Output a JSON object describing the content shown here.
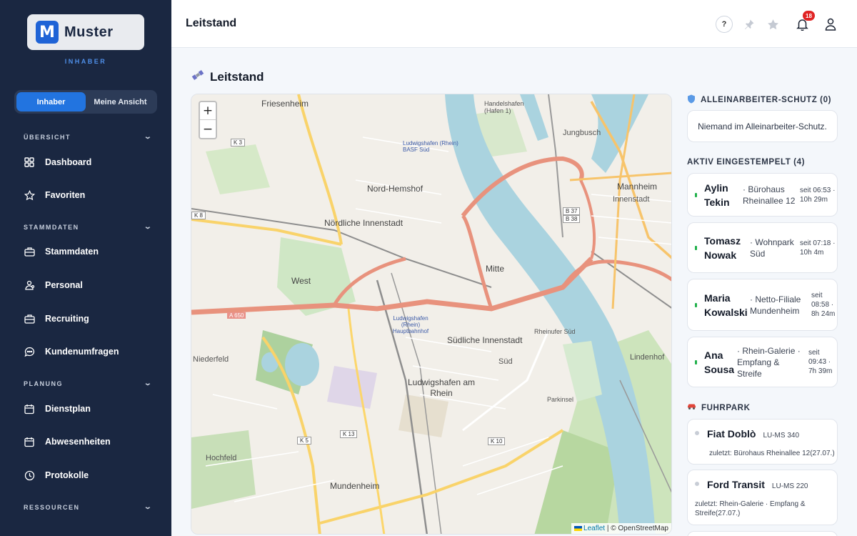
{
  "brand": {
    "name": "Muster",
    "logo_letter": "M",
    "role": "INHABER"
  },
  "view_toggle": {
    "options": [
      "Inhaber",
      "Meine Ansicht"
    ],
    "active": "Inhaber"
  },
  "sidebar": {
    "sections": [
      {
        "title": "ÜBERSICHT",
        "items": [
          {
            "label": "Dashboard",
            "icon": "grid-icon"
          },
          {
            "label": "Favoriten",
            "icon": "star-icon"
          }
        ]
      },
      {
        "title": "STAMMDATEN",
        "items": [
          {
            "label": "Stammdaten",
            "icon": "briefcase-icon"
          },
          {
            "label": "Personal",
            "icon": "people-icon"
          },
          {
            "label": "Recruiting",
            "icon": "briefcase-icon"
          },
          {
            "label": "Kundenumfragen",
            "icon": "chat-icon"
          }
        ]
      },
      {
        "title": "PLANUNG",
        "items": [
          {
            "label": "Dienstplan",
            "icon": "calendar-icon"
          },
          {
            "label": "Abwesenheiten",
            "icon": "calendar-icon"
          },
          {
            "label": "Protokolle",
            "icon": "clock-icon"
          }
        ]
      },
      {
        "title": "RESSOURCEN",
        "items": []
      }
    ]
  },
  "topbar": {
    "title": "Leitstand",
    "help": "?",
    "notifications_count": "18"
  },
  "page": {
    "title": "Leitstand"
  },
  "map": {
    "zoom_in": "+",
    "zoom_out": "−",
    "attribution": {
      "leaflet": "Leaflet",
      "separator": " | © ",
      "osm": "OpenStreetMap"
    },
    "labels": {
      "friesenheim": "Friesenheim",
      "nord_hemshof": "Nord-Hemshof",
      "noerdliche_innenstadt": "Nördliche Innenstadt",
      "west": "West",
      "mitte": "Mitte",
      "mannheim": "Mannheim",
      "innenstadt": "Innenstadt",
      "jungbusch": "Jungbusch",
      "suedliche_innenstadt": "Südliche Innenstadt",
      "sued": "Süd",
      "ludwigshafen_am_rhein": "Ludwigshafen am Rhein",
      "niederfeld": "Niederfeld",
      "hochfeld": "Hochfeld",
      "mundenheim": "Mundenheim",
      "rheinauer_sued": "Rheinufer Süd",
      "lindenhof": "Lindenhof",
      "parkinsel": "Parkinsel",
      "hbf": "Ludwigshafen (Rhein) Hauptbahnhof",
      "basf": "Ludwigshafen (Rhein) BASF Süd",
      "handelshafen": "Handelshafen (Hafen 1)",
      "k3": "K 3",
      "k8": "K 8",
      "a650": "A 650",
      "k13": "K 13",
      "k10": "K 10",
      "k5": "K 5",
      "b37": "B 37",
      "b38": "B 38"
    }
  },
  "alleinarbeiter": {
    "title": "ALLEINARBEITER-SCHUTZ (0)",
    "empty": "Niemand im Alleinarbeiter-Schutz."
  },
  "active": {
    "title": "AKTIV EINGESTEMPELT (4)",
    "employees": [
      {
        "name": "Aylin Tekin",
        "location": "· Bürohaus Rheinallee 12",
        "time": "seit 06:53 · 10h 29m"
      },
      {
        "name": "Tomasz Nowak",
        "location": "· Wohnpark Süd",
        "time": "seit 07:18 · 10h 4m"
      },
      {
        "name": "Maria Kowalski",
        "location": "· Netto-Filiale Mundenheim",
        "time": "seit 08:58 · 8h 24m"
      },
      {
        "name": "Ana Sousa",
        "location": "· Rhein-Galerie · Empfang & Streife",
        "time": "seit 09:43 · 7h 39m"
      }
    ]
  },
  "fleet": {
    "title": "FUHRPARK",
    "vehicles": [
      {
        "name": "Fiat Doblò",
        "plate": "LU-MS 340",
        "last": "zuletzt: Bürohaus Rheinallee 12(27.07.)"
      },
      {
        "name": "Ford Transit",
        "plate": "LU-MS 220",
        "last": "zuletzt: Rhein-Galerie · Empfang & Streife(27.07.)"
      }
    ]
  },
  "colors": {
    "sidebar_bg": "#1a2741",
    "accent": "#2274e0",
    "active_dot": "#22b14c",
    "badge": "#e02424"
  }
}
